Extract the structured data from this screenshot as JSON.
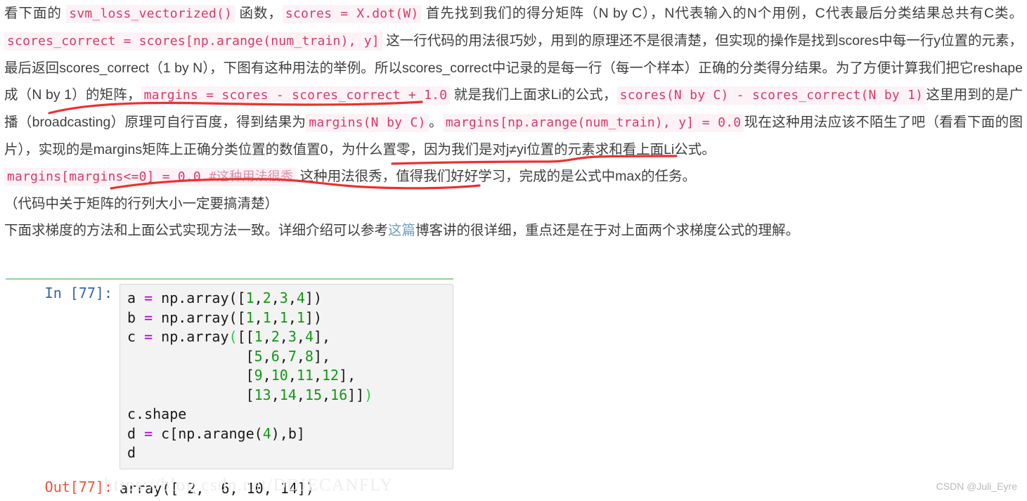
{
  "colors": {
    "inline_code_text": "#d63b66",
    "inline_code_bg": "#fdf2f6",
    "link": "#6f9ec9",
    "annotation_red": "#e8332f",
    "divider_green": "#8fd19e",
    "prompt_in": "#3465a4",
    "prompt_out": "#e8553a",
    "code_number": "#119911",
    "code_operator": "#aa00d4",
    "body_text": "#3f3f3f"
  },
  "prose": {
    "p1": {
      "t1": "看下面的 ",
      "c1": "svm_loss_vectorized()",
      "t2": " 函数，",
      "c2": "scores = X.dot(W)",
      "t3": " 首先找到我们的得分矩阵（N by C），N代表输入的N个用例，C代表最后分类结果总共有C类。 ",
      "c3": "scores_correct = scores[np.arange(num_train), y]",
      "t4": " 这一行代码的用法很巧妙，用到的原理还不是很清楚，但实现的操作是找到scores中每一行y位置的元素，最后返回scores_correct（1 by N），下图有这种用法的举例。所以scores_correct中记录的是每一行（每一个样本）正确的分类得分结果。为了方便计算我们把它reshape成（N by 1）的矩阵，",
      "c4": "margins = scores - scores_correct + 1.0",
      "t5": " 就是我们上面求Li的公式，",
      "c5": "scores(N by C) - scores_correct(N by 1)",
      "t6": "这里用到的是广播（broadcasting）原理可自行百度，得到结果为",
      "c6": "margins(N by C)",
      "t7": "。",
      "c7": "margins[np.arange(num_train), y] = 0.0",
      "t8": "现在这种用法应该不陌生了吧（看看下面的图片），实现的是margins矩阵上正确分类位置的数值置0，为什么置零，因为我们是对j≠yi位置的元素求和看上面Li公式。"
    },
    "p2": {
      "c1": "margins[margins<=0] = 0.0 ",
      "c1_comment": "#这种用法很秀",
      "t1": " 这种用法很秀，值得我们好好学习，完成的是公式中max的任务。"
    },
    "p3": {
      "t1": "（代码中关于矩阵的行列大小一定要搞清楚）"
    },
    "p4": {
      "t1": "下面求梯度的方法和上面公式实现方法一致。详细介绍可以参考",
      "link": "这篇",
      "t2": "博客讲的很详细，重点还是在于对上面两个求梯度公式的理解。"
    }
  },
  "notebook": {
    "in_prompt": "In [77]:",
    "out_prompt": "Out[77]:",
    "code_lines": [
      "a = np.array([1,2,3,4])",
      "b = np.array([1,1,1,1])",
      "c = np.array([[1,2,3,4],",
      "              [5,6,7,8],",
      "              [9,10,11,12],",
      "              [13,14,15,16]])",
      "c.shape",
      "d = c[np.arange(4),b]",
      "d"
    ],
    "output": "array([ 2,  6, 10, 14])"
  },
  "watermarks": {
    "url": "https://blog.csdn.net/DDIECANFLY",
    "csdn": "CSDN @Juli_Eyre"
  }
}
